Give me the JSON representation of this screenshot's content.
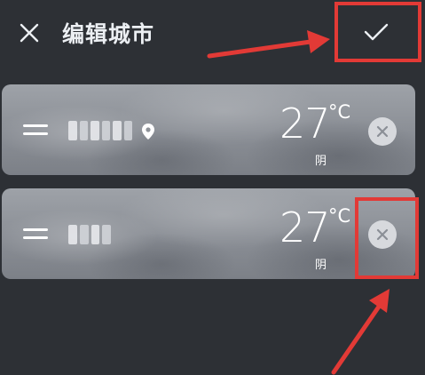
{
  "header": {
    "title": "编辑城市",
    "close_icon": "close-icon",
    "confirm_icon": "checkmark-icon"
  },
  "cities": [
    {
      "name": "",
      "is_current_location": true,
      "temperature": "27",
      "unit": "°C",
      "condition": "阴"
    },
    {
      "name": "",
      "is_current_location": false,
      "temperature": "27",
      "unit": "°C",
      "condition": "阴"
    }
  ],
  "annotations": {
    "highlight_color": "#e23a36",
    "highlighted_targets": [
      "confirm-button",
      "remove-city-button-2"
    ]
  },
  "colors": {
    "background": "#2d3035",
    "card": "#8a8e95",
    "text": "#ffffff"
  }
}
